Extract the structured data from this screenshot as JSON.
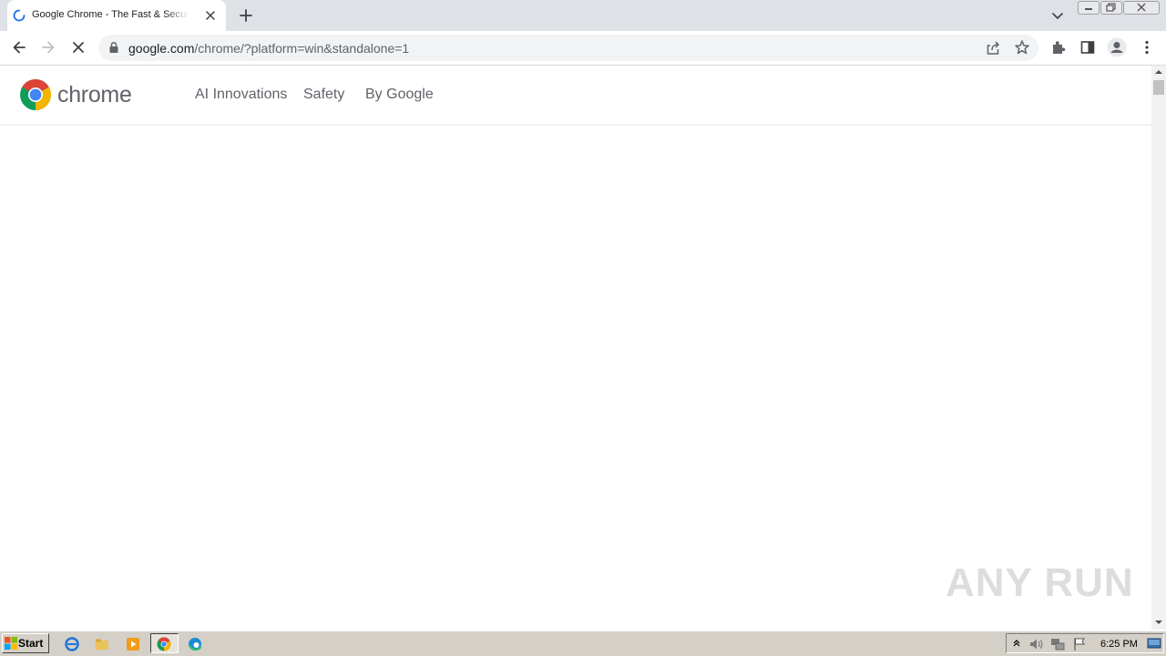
{
  "browser": {
    "tab": {
      "title": "Google Chrome - The Fast & Secure Web Browser Built to be Yours"
    },
    "address_bar": {
      "host": "google.com",
      "path": "/chrome/?platform=win&standalone=1"
    },
    "icons": {
      "tab_spinner": "loading-spinner-icon",
      "tab_close": "close-icon",
      "new_tab": "plus-icon",
      "tab_search": "chevron-down-icon",
      "back": "arrow-left-icon",
      "forward": "arrow-right-icon",
      "stop": "stop-x-icon",
      "lock": "lock-icon",
      "share": "share-icon",
      "bookmark": "star-icon",
      "extensions": "puzzle-icon",
      "side_panel": "side-panel-icon",
      "profile": "profile-icon",
      "menu": "kebab-menu-icon"
    }
  },
  "site": {
    "logo_word": "chrome",
    "nav": [
      {
        "label": "AI Innovations"
      },
      {
        "label": "Safety"
      },
      {
        "label": "By Google"
      }
    ]
  },
  "watermark": {
    "text": "ANY RUN"
  },
  "taskbar": {
    "start_label": "Start",
    "clock": "6:25 PM"
  },
  "colors": {
    "tabstrip_bg": "#dee1e6",
    "omnibox_bg": "#f1f3f4",
    "nav_text": "#5f6368",
    "taskbar_bg": "#d4d0c8",
    "chrome_red": "#db4437",
    "chrome_yellow": "#f4b400",
    "chrome_green": "#0f9d58",
    "chrome_blue": "#4285f4"
  }
}
